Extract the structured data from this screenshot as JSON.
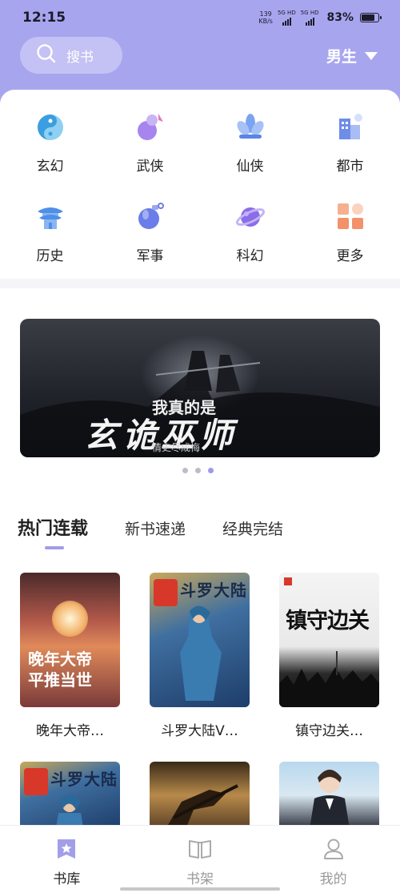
{
  "status_bar": {
    "time": "12:15",
    "net_speed": "139",
    "net_unit": "KB/s",
    "signal1": "5G HD",
    "signal2": "5G HD",
    "battery": "83%",
    "battery_level": 0.83
  },
  "header": {
    "search_placeholder": "搜书",
    "gender_label": "男生"
  },
  "categories": [
    {
      "label": "玄幻",
      "icon": "yin-yang-icon",
      "color": "#5fb8e8"
    },
    {
      "label": "武侠",
      "icon": "gourd-icon",
      "color": "#9b7de8"
    },
    {
      "label": "仙侠",
      "icon": "lotus-icon",
      "color": "#6a8de8"
    },
    {
      "label": "都市",
      "icon": "buildings-icon",
      "color": "#6a84e8"
    },
    {
      "label": "历史",
      "icon": "palace-icon",
      "color": "#4f8fe8"
    },
    {
      "label": "军事",
      "icon": "grenade-icon",
      "color": "#6a7de8"
    },
    {
      "label": "科幻",
      "icon": "planet-icon",
      "color": "#8a6de8"
    },
    {
      "label": "更多",
      "icon": "grid-icon",
      "color": "#f2916a"
    }
  ],
  "banner": {
    "title": "我真的是",
    "big_text": "玄诡巫师",
    "author": "情史尽成悔"
  },
  "tabs": [
    {
      "label": "热门连载",
      "active": true
    },
    {
      "label": "新书速递",
      "active": false
    },
    {
      "label": "经典完结",
      "active": false
    }
  ],
  "books": [
    {
      "title": "晚年大帝…",
      "cover_text": "晚年大帝 平推当世"
    },
    {
      "title": "斗罗大陆V…",
      "cover_text": "斗罗大陆"
    },
    {
      "title": "镇守边关…",
      "cover_text": "镇守边关"
    }
  ],
  "bottom_nav": [
    {
      "label": "书库",
      "icon": "star-book-icon",
      "active": true
    },
    {
      "label": "书架",
      "icon": "bookshelf-icon",
      "active": false
    },
    {
      "label": "我的",
      "icon": "user-icon",
      "active": false
    }
  ]
}
